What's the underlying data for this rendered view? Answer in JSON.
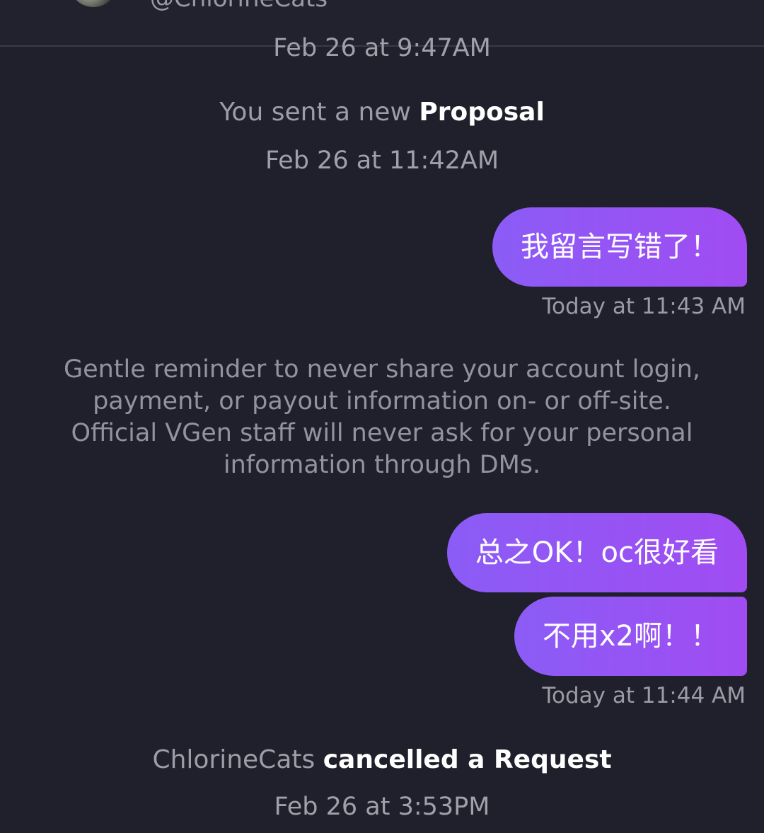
{
  "header": {
    "handle": "@ChlorineCats"
  },
  "timeline": {
    "top_timestamp": "Feb 26 at 9:47AM",
    "proposal_event": {
      "prefix": "You sent a new",
      "object": "Proposal",
      "timestamp": "Feb 26 at 11:42AM"
    },
    "message_1": {
      "text": "我留言写错了！",
      "timestamp": "Today at 11:43 AM"
    },
    "safety_notice": {
      "lines": [
        "Gentle reminder to never share your account login,",
        "payment, or payout information on- or off-site.",
        "Official VGen staff will never ask for your personal",
        "information through DMs."
      ]
    },
    "message_2": {
      "text": "总之OK！oc很好看"
    },
    "message_3": {
      "text": "不用x2啊！！",
      "timestamp": "Today at 11:44 AM"
    },
    "cancel_event": {
      "actor": "ChlorineCats",
      "action": "cancelled a Request",
      "timestamp": "Feb 26 at 3:53PM"
    }
  },
  "colors": {
    "background": "#20202c",
    "bubble_gradient_start": "#8b5cf6",
    "bubble_gradient_end": "#a04cf2",
    "muted_text": "#9d9da7"
  }
}
